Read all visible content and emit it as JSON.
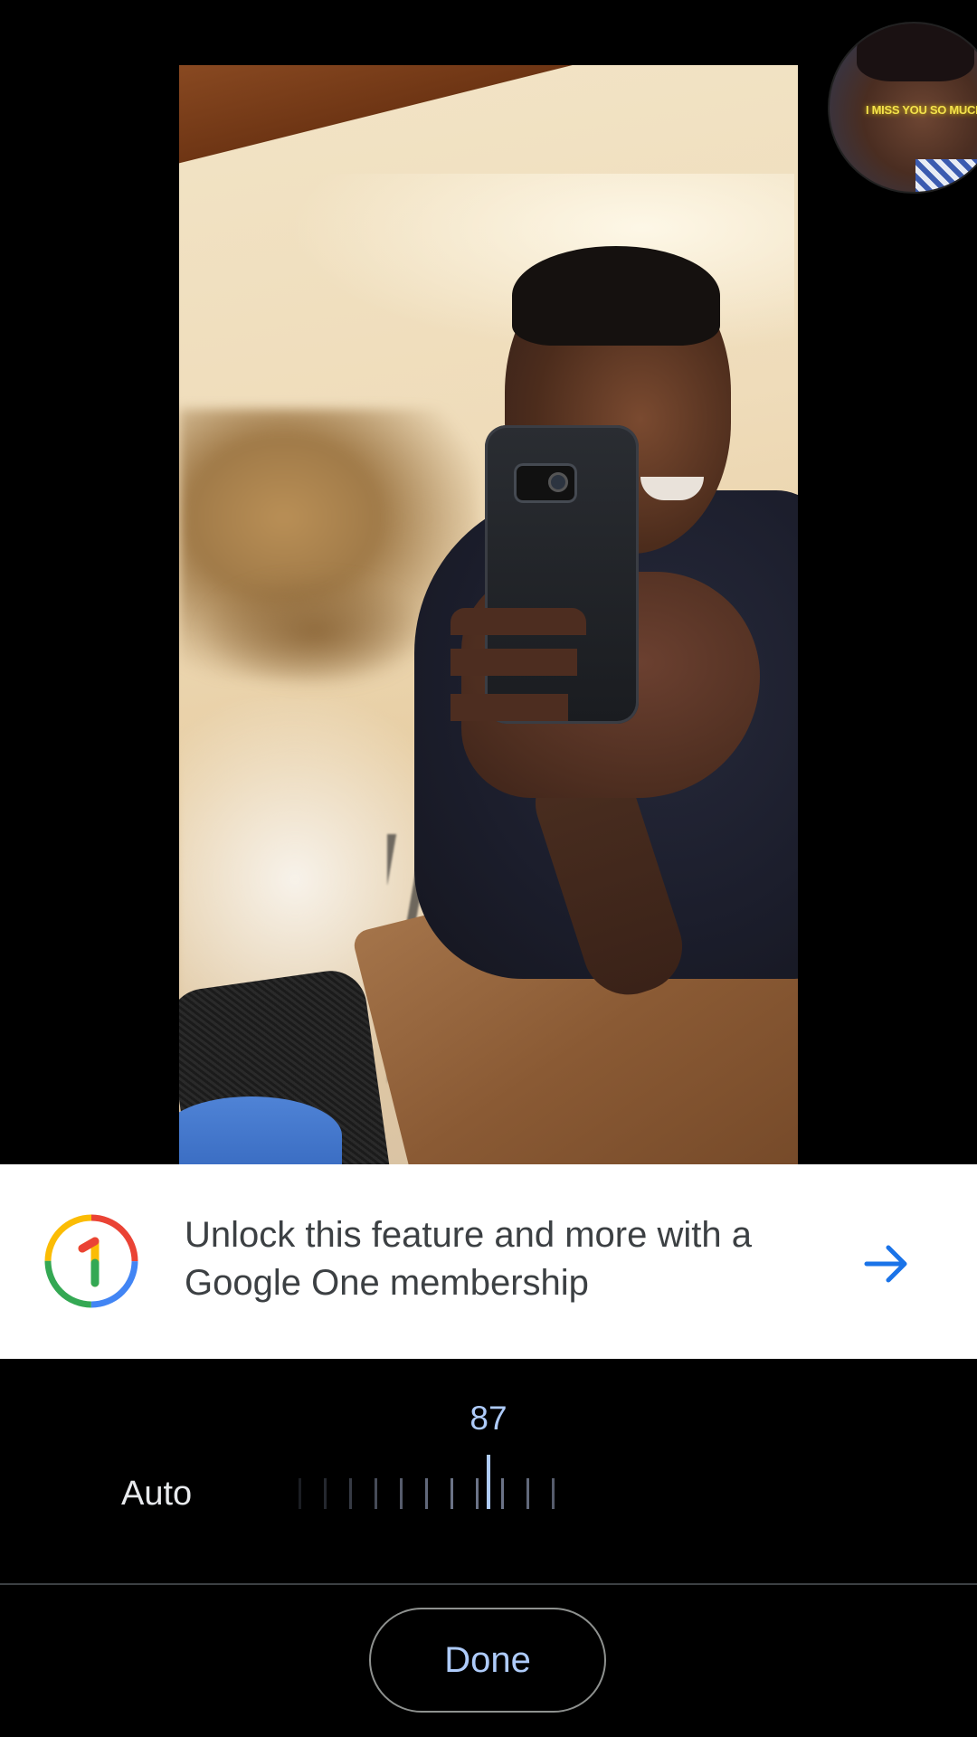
{
  "photo": {
    "subject": "person taking mirror selfie"
  },
  "avatar": {
    "caption": "I MISS YOU SO MUCH"
  },
  "upsell": {
    "logo_icon": "google-one-logo-icon",
    "message": "Unlock this feature and more with a Google One membership",
    "arrow_icon": "arrow-right-icon",
    "accent_color": "#1a73e8"
  },
  "adjust": {
    "value": "87",
    "auto_label": "Auto"
  },
  "footer": {
    "done_label": "Done"
  },
  "colors": {
    "background": "#000000",
    "slider_accent": "#aecbfa",
    "banner_background": "#ffffff"
  }
}
